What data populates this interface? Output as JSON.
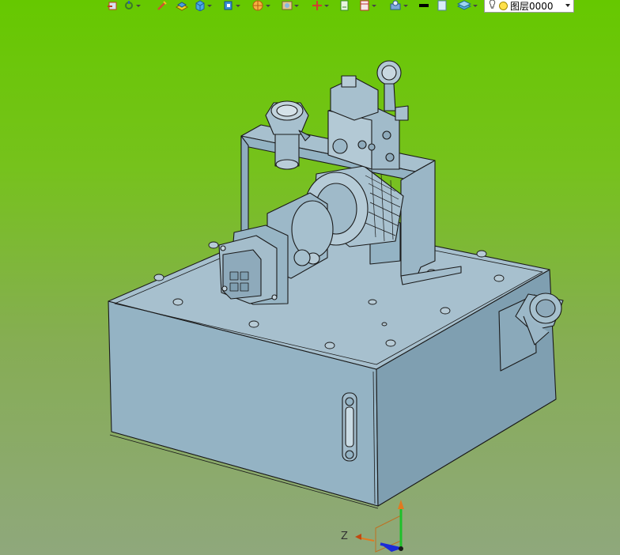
{
  "toolbar": {
    "icons": [
      "view-icon",
      "rotate-icon",
      "sketch-icon",
      "solid-icon",
      "cube-icon",
      "shell-icon",
      "sphere-icon",
      "render-icon",
      "axis-icon",
      "page-icon",
      "frame-icon",
      "assembly-icon",
      "line-color-icon",
      "fill-color-icon",
      "layer-stack-icon"
    ]
  },
  "layer": {
    "name": "图层0000"
  },
  "triad": {
    "z_label": "Z"
  },
  "colors": {
    "bg_top": "#66c800",
    "bg_bottom": "#8fa87c",
    "model_fill": "#97b5c5",
    "model_dark": "#7b9aac",
    "model_light": "#a9c2d0",
    "edge": "#1a1a1a"
  }
}
